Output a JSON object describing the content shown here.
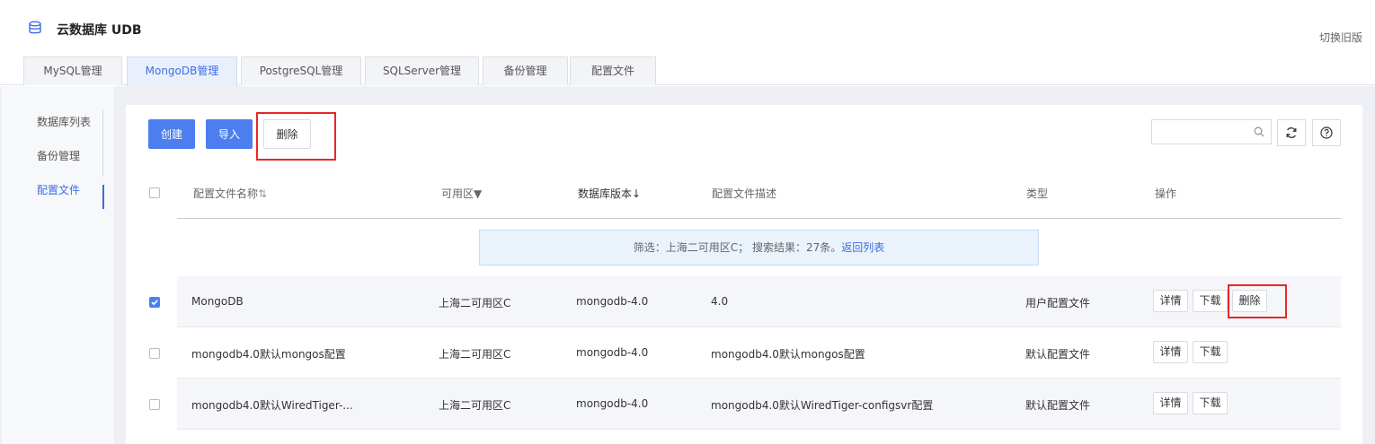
{
  "app": {
    "title": "云数据库 UDB",
    "switch_label": "切换旧版"
  },
  "tabs": [
    {
      "label": "MySQL管理"
    },
    {
      "label": "MongoDB管理"
    },
    {
      "label": "PostgreSQL管理"
    },
    {
      "label": "SQLServer管理"
    },
    {
      "label": "备份管理"
    },
    {
      "label": "配置文件"
    }
  ],
  "active_tab": "MongoDB管理",
  "sidebar": {
    "items": [
      {
        "label": "数据库列表"
      },
      {
        "label": "备份管理"
      },
      {
        "label": "配置文件"
      }
    ]
  },
  "toolbar": {
    "create_label": "创建",
    "import_label": "导入",
    "delete_label": "删除"
  },
  "table": {
    "headers": {
      "name": "配置文件名称",
      "zone": "可用区",
      "version": "数据库版本",
      "desc": "配置文件描述",
      "type": "类型",
      "ops": "操作"
    },
    "filter": {
      "text": "筛选：上海二可用区C； 搜索结果：27条。",
      "link": "返回列表"
    },
    "rows": [
      {
        "name": "MongoDB",
        "zone": "上海二可用区C",
        "version": "mongodb-4.0",
        "desc": "4.0",
        "type": "用户配置文件",
        "checked": true
      },
      {
        "name": "mongodb4.0默认mongos配置",
        "zone": "上海二可用区C",
        "version": "mongodb-4.0",
        "desc": "mongodb4.0默认mongos配置",
        "type": "默认配置文件",
        "checked": false
      },
      {
        "name": "mongodb4.0默认WiredTiger-...",
        "zone": "上海二可用区C",
        "version": "mongodb-4.0",
        "desc": "mongodb4.0默认WiredTiger-configsvr配置",
        "type": "默认配置文件",
        "checked": false
      }
    ],
    "ops": {
      "detail": "详情",
      "download": "下载",
      "delete": "删除"
    }
  },
  "colors": {
    "primary": "#4d7ef0",
    "highlight": "#e8262a",
    "link": "#3c6ce8"
  },
  "icons": [
    "database-icon",
    "search-icon",
    "refresh-icon",
    "help-icon",
    "sort-icon",
    "filter-icon",
    "sort-down-icon",
    "check-icon"
  ]
}
